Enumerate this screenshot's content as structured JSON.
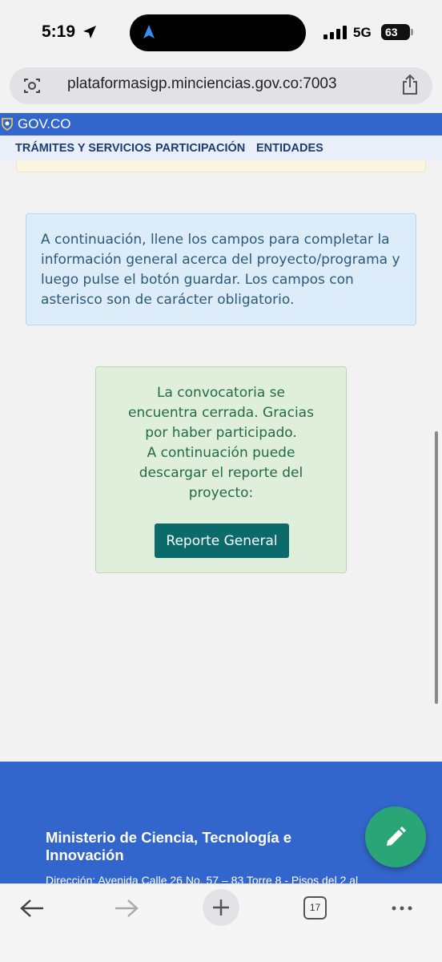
{
  "status_bar": {
    "time": "5:19",
    "network": "5G",
    "battery": "63"
  },
  "browser": {
    "url": "plataformasigp.minciencias.gov.co:7003",
    "tabs_count": "17"
  },
  "gov_header": {
    "label": "GOV.CO",
    "nav": [
      "TRÁMITES Y SERVICIOS",
      "PARTICIPACIÓN",
      "ENTIDADES"
    ]
  },
  "info_box": {
    "text": "A continuación, llene los campos para completar la información general acerca del proyecto/programa y luego pulse el botón guardar. Los campos con asterisco son de carácter obligatorio."
  },
  "success_box": {
    "text_line1": "La convocatoria se encuentra cerrada. Gracias por haber participado.",
    "text_line2": "A continuación puede descargar el reporte del proyecto:",
    "button_label": "Reporte General"
  },
  "footer": {
    "title": "Ministerio de Ciencia, Tecnología e Innovación",
    "address": "Dirección: Avenida Calle 26 No. 57 – 83 Torre 8 - Pisos del 2 al"
  },
  "colors": {
    "gov_blue": "#3366cc",
    "button_teal": "#0b6b6b",
    "fab_green": "#2aa676"
  }
}
